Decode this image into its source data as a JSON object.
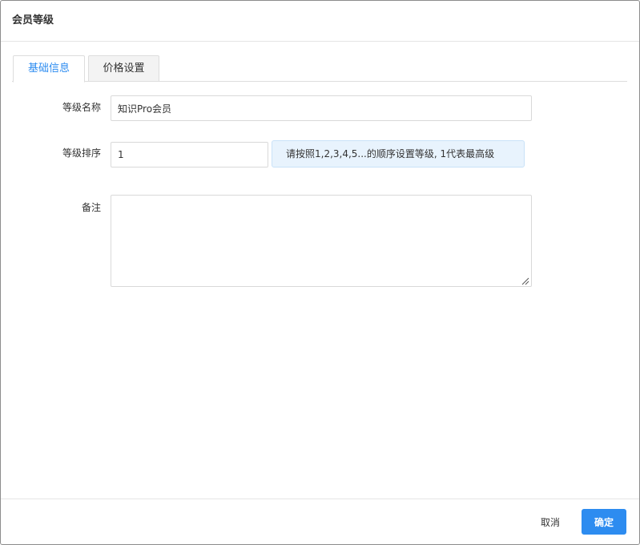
{
  "dialog": {
    "title": "会员等级"
  },
  "tabs": [
    {
      "label": "基础信息",
      "active": true
    },
    {
      "label": "价格设置",
      "active": false
    }
  ],
  "form": {
    "name": {
      "label": "等级名称",
      "value": "知识Pro会员"
    },
    "sort": {
      "label": "等级排序",
      "value": "1",
      "hint": "请按照1,2,3,4,5...的顺序设置等级, 1代表最高级"
    },
    "remark": {
      "label": "备注",
      "value": ""
    }
  },
  "footer": {
    "cancel_label": "取消",
    "ok_label": "确定"
  },
  "colors": {
    "accent": "#2d8cf0",
    "hint_bg": "#e8f3fd",
    "border": "#d9d9d9"
  }
}
